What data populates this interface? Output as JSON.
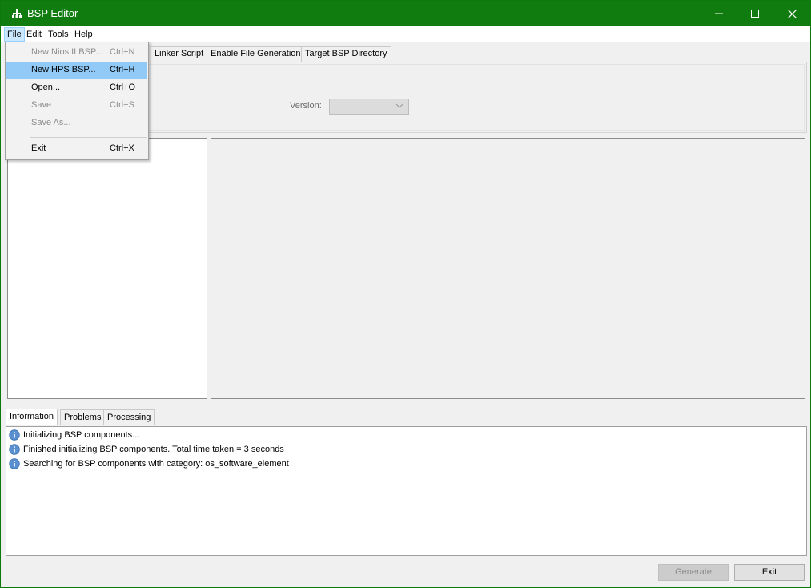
{
  "window": {
    "title": "BSP Editor",
    "accent": "#107c10"
  },
  "menubar": {
    "items": [
      "File",
      "Edit",
      "Tools",
      "Help"
    ]
  },
  "file_menu": {
    "items": [
      {
        "label": "New Nios II BSP...",
        "shortcut": "Ctrl+N",
        "enabled": false
      },
      {
        "label": "New HPS BSP...",
        "shortcut": "Ctrl+H",
        "enabled": true,
        "highlighted": true
      },
      {
        "label": "Open...",
        "shortcut": "Ctrl+O",
        "enabled": true
      },
      {
        "label": "Save",
        "shortcut": "Ctrl+S",
        "enabled": false
      },
      {
        "label": "Save As...",
        "shortcut": "",
        "enabled": false
      },
      {
        "label": "Exit",
        "shortcut": "Ctrl+X",
        "enabled": true
      }
    ]
  },
  "top_tabs": [
    "Linker Script",
    "Enable File Generation",
    "Target BSP Directory"
  ],
  "settings": {
    "version_label": "Version:",
    "version_value": ""
  },
  "bottom_tabs": [
    "Information",
    "Problems",
    "Processing"
  ],
  "log": [
    "Initializing BSP components...",
    "Finished initializing BSP components. Total time taken = 3 seconds",
    "Searching for BSP components with category: os_software_element"
  ],
  "buttons": {
    "generate": "Generate",
    "exit": "Exit"
  }
}
